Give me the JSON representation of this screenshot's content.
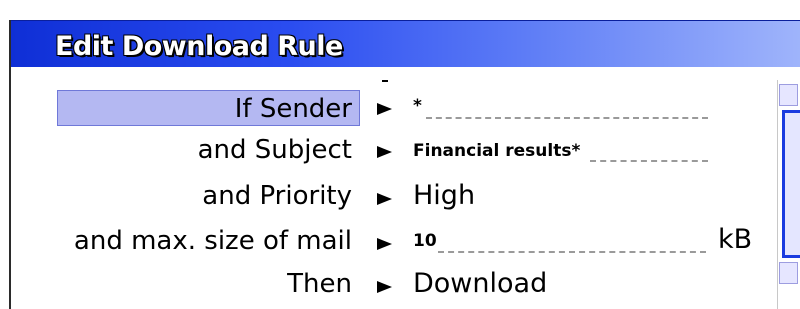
{
  "dialog": {
    "title": "Edit Download Rule"
  },
  "rules": [
    {
      "label": "If Sender",
      "value": "*",
      "selected": true
    },
    {
      "label": "and Subject",
      "value": "Financial results*",
      "selected": false
    },
    {
      "label": "and Priority",
      "value": "High",
      "selected": false
    },
    {
      "label": "and max. size of mail",
      "value": "10",
      "unit": "kB",
      "selected": false
    },
    {
      "label": "Then",
      "value": "Download",
      "selected": false
    }
  ],
  "colors": {
    "title_gradient_start": "#0f2fd6",
    "title_gradient_end": "#9fb4fb",
    "selection": "#b4b8f2",
    "scroll_thumb_border": "#1a3be0"
  },
  "icons": {
    "row_pointer": "right-triangle"
  }
}
